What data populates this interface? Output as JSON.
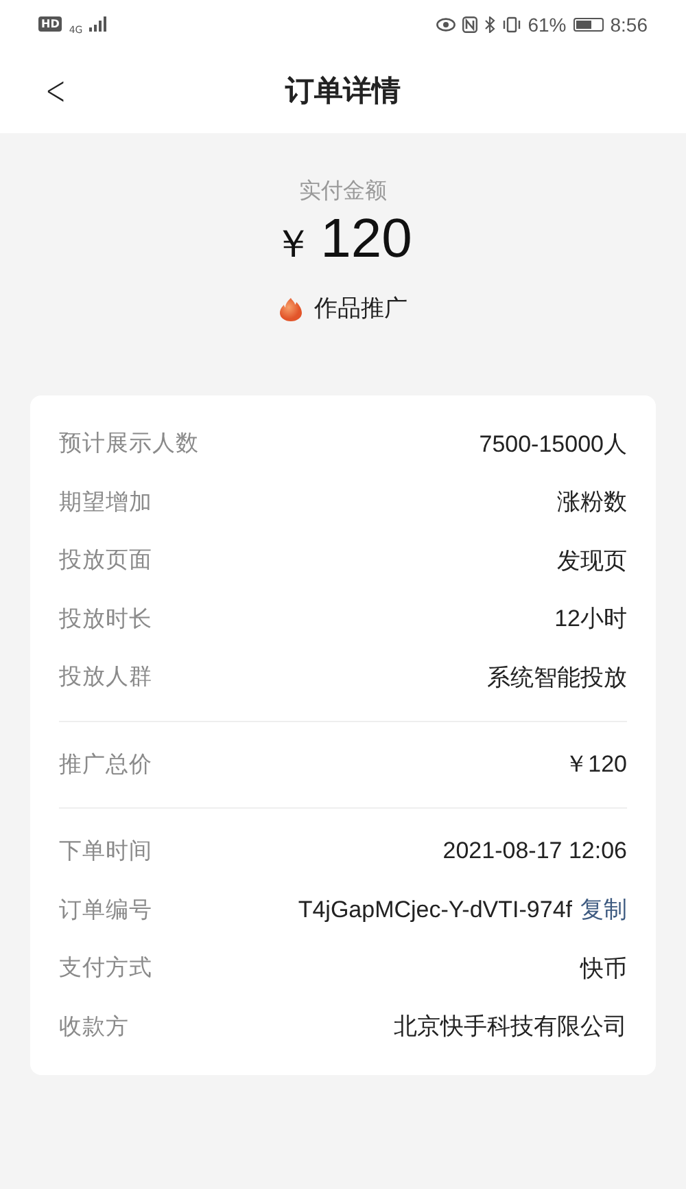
{
  "status_bar": {
    "hd": "HD",
    "network": "4G",
    "battery_text": "61%",
    "time": "8:56"
  },
  "header": {
    "back": "<",
    "title": "订单详情"
  },
  "summary": {
    "label": "实付金额",
    "currency": "￥",
    "amount": "120",
    "product": "作品推广"
  },
  "sections": [
    {
      "rows": [
        {
          "label": "预计展示人数",
          "value": "7500-15000人"
        },
        {
          "label": "期望增加",
          "value": "涨粉数"
        },
        {
          "label": "投放页面",
          "value": "发现页"
        },
        {
          "label": "投放时长",
          "value": "12小时"
        },
        {
          "label": "投放人群",
          "value": "系统智能投放"
        }
      ]
    },
    {
      "rows": [
        {
          "label": "推广总价",
          "value": "￥120"
        }
      ]
    },
    {
      "rows": [
        {
          "label": "下单时间",
          "value": "2021-08-17 12:06"
        },
        {
          "label": "订单编号",
          "value": "T4jGapMCjec-Y-dVTI-974f",
          "action": "复制"
        },
        {
          "label": "支付方式",
          "value": "快币"
        },
        {
          "label": "收款方",
          "value": "北京快手科技有限公司"
        }
      ]
    }
  ]
}
